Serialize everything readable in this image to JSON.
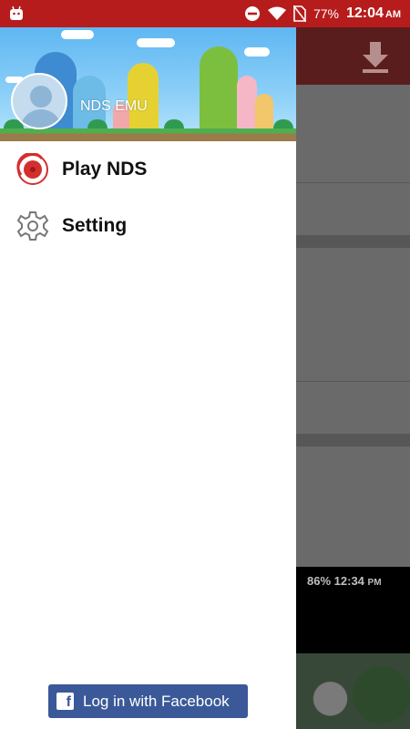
{
  "status_bar": {
    "battery_percent": "77%",
    "time": "12:04",
    "ampm": "AM",
    "icons": [
      "android-debug-icon",
      "do-not-disturb-icon",
      "wifi-icon",
      "no-sim-icon",
      "battery-icon"
    ]
  },
  "background_app": {
    "toolbar_icon": "download-icon",
    "preview": {
      "battery_percent": "86%",
      "time": "12:34",
      "ampm": "PM"
    }
  },
  "drawer": {
    "username": "NDS EMU",
    "menu": [
      {
        "label": "Play NDS",
        "icon": "play-disc-icon"
      },
      {
        "label": "Setting",
        "icon": "gear-icon"
      }
    ],
    "facebook_button": {
      "label": "Log in with Facebook",
      "icon": "facebook-icon"
    }
  },
  "colors": {
    "status_bar": "#b71c1c",
    "facebook_blue": "#3b5998",
    "menu_accent": "#d32f2f"
  }
}
